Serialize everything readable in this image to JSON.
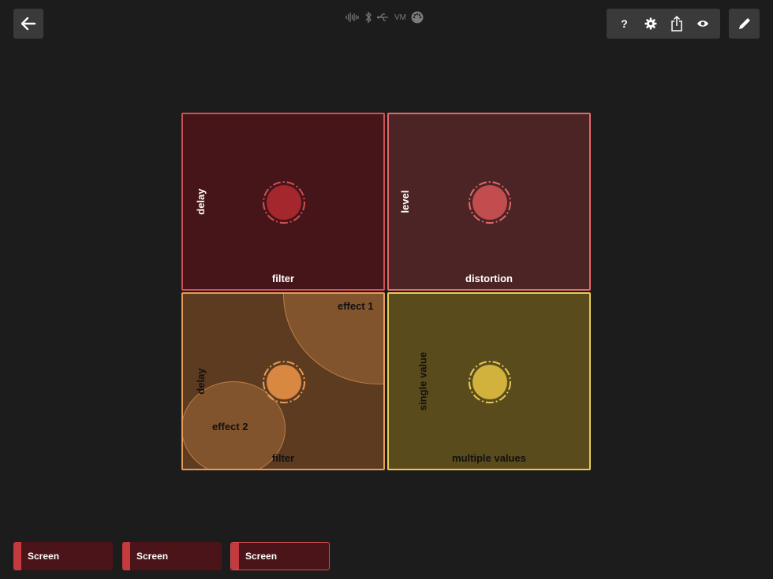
{
  "colors": {
    "background": "#1c1c1c",
    "pad_filter_delay": "#461519",
    "pad_distortion_level": "#4c2425",
    "pad_effects": "#5c3b21",
    "pad_single_multiple": "#5a4b1d"
  },
  "toolbar": {
    "help_label": "?",
    "icons": [
      "back-arrow-icon",
      "gear-icon",
      "share-icon",
      "eye-icon",
      "pencil-icon"
    ]
  },
  "status": {
    "vm_label": "VM",
    "icons": [
      "audio-wave-icon",
      "bluetooth-icon",
      "usb-icon",
      "midi-icon"
    ]
  },
  "pads": {
    "top_left": {
      "x_label": "filter",
      "y_label": "delay"
    },
    "top_right": {
      "x_label": "distortion",
      "y_label": "level"
    },
    "bottom_left": {
      "x_label": "filter",
      "y_label": "delay",
      "zone1_label": "effect 1",
      "zone2_label": "effect 2"
    },
    "bottom_right": {
      "x_label": "multiple values",
      "y_label": "single value"
    }
  },
  "screens": [
    {
      "label": "Screen"
    },
    {
      "label": "Screen"
    },
    {
      "label": "Screen"
    }
  ]
}
